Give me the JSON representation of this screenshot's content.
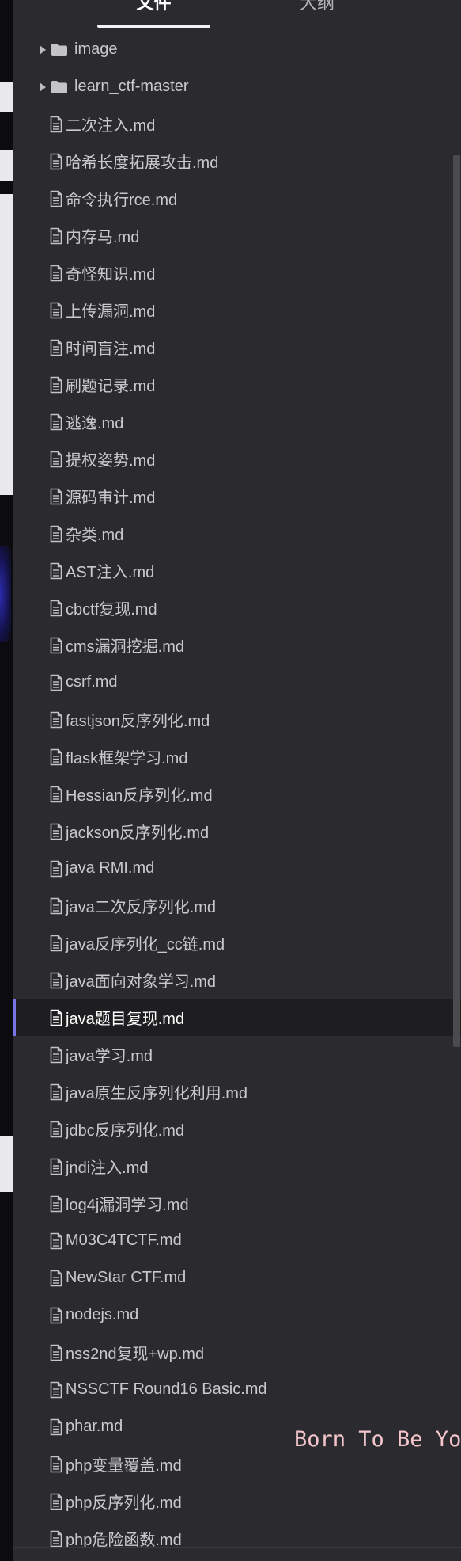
{
  "tabs": [
    {
      "label": "文件",
      "active": true
    },
    {
      "label": "大纲",
      "active": false
    }
  ],
  "folders": [
    {
      "label": "image",
      "icon": "folder-icon"
    },
    {
      "label": "learn_ctf-master",
      "icon": "folder-icon"
    }
  ],
  "files": [
    {
      "label": "二次注入.md"
    },
    {
      "label": "哈希长度拓展攻击.md"
    },
    {
      "label": "命令执行rce.md"
    },
    {
      "label": "内存马.md"
    },
    {
      "label": "奇怪知识.md"
    },
    {
      "label": "上传漏洞.md"
    },
    {
      "label": "时间盲注.md"
    },
    {
      "label": "刷题记录.md"
    },
    {
      "label": "逃逸.md"
    },
    {
      "label": "提权姿势.md"
    },
    {
      "label": "源码审计.md"
    },
    {
      "label": "杂类.md"
    },
    {
      "label": "AST注入.md"
    },
    {
      "label": "cbctf复现.md"
    },
    {
      "label": "cms漏洞挖掘.md"
    },
    {
      "label": "csrf.md"
    },
    {
      "label": "fastjson反序列化.md"
    },
    {
      "label": "flask框架学习.md"
    },
    {
      "label": "Hessian反序列化.md"
    },
    {
      "label": "jackson反序列化.md"
    },
    {
      "label": "java RMI.md"
    },
    {
      "label": "java二次反序列化.md"
    },
    {
      "label": "java反序列化_cc链.md"
    },
    {
      "label": "java面向对象学习.md"
    },
    {
      "label": "java题目复现.md",
      "active": true
    },
    {
      "label": "java学习.md"
    },
    {
      "label": "java原生反序列化利用.md"
    },
    {
      "label": "jdbc反序列化.md"
    },
    {
      "label": "jndi注入.md"
    },
    {
      "label": "log4j漏洞学习.md"
    },
    {
      "label": "M03C4TCTF.md"
    },
    {
      "label": "NewStar CTF.md"
    },
    {
      "label": "nodejs.md"
    },
    {
      "label": "nss2nd复现+wp.md"
    },
    {
      "label": "NSSCTF Round16 Basic.md"
    },
    {
      "label": "phar.md"
    },
    {
      "label": "php变量覆盖.md"
    },
    {
      "label": "php反序列化.md"
    },
    {
      "label": "php危险函数.md"
    }
  ],
  "overlay": {
    "slogan": "Born To Be You"
  },
  "colors": {
    "sidebar_bg": "#2b2b2f",
    "active_row_bg": "#1e1e21",
    "accent": "#7b74e6",
    "slogan": "#f4c6cc"
  }
}
